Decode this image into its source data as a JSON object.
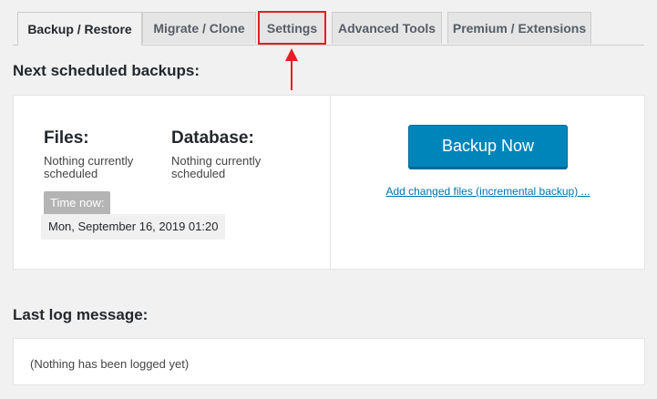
{
  "tabs": [
    {
      "label": "Backup / Restore"
    },
    {
      "label": "Migrate / Clone"
    },
    {
      "label": "Settings"
    },
    {
      "label": "Advanced Tools"
    },
    {
      "label": "Premium / Extensions"
    }
  ],
  "schedule": {
    "heading": "Next scheduled backups:",
    "files_title": "Files:",
    "files_status": "Nothing currently scheduled",
    "database_title": "Database:",
    "database_status": "Nothing currently scheduled",
    "time_now_label": "Time now:",
    "time_now_value": "Mon, September 16, 2019 01:20",
    "backup_now_label": "Backup Now",
    "incremental_link": "Add changed files (incremental backup) ..."
  },
  "log": {
    "heading": "Last log message:",
    "message": "(Nothing has been logged yet)"
  },
  "colors": {
    "annotation_red": "#e31e24",
    "primary_button": "#0085ba",
    "link": "#0073aa"
  }
}
